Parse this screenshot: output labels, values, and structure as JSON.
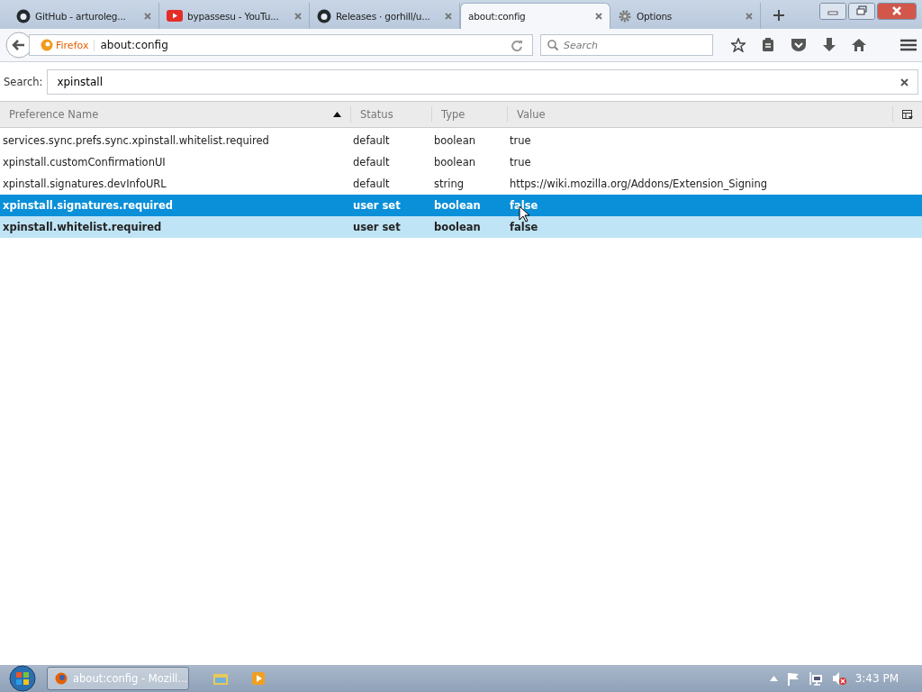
{
  "tabs": [
    {
      "title": "GitHub - arturoleg...",
      "kind": "github",
      "selected": false
    },
    {
      "title": "bypassesu - YouTu...",
      "kind": "youtube",
      "selected": false
    },
    {
      "title": "Releases · gorhill/u...",
      "kind": "github",
      "selected": false
    },
    {
      "title": "about:config",
      "kind": "plain",
      "selected": true
    },
    {
      "title": "Options",
      "kind": "gear",
      "selected": false
    }
  ],
  "navbar": {
    "identity": "Firefox",
    "url": "about:config",
    "search_placeholder": "Search"
  },
  "filter": {
    "label": "Search:",
    "value": "xpinstall"
  },
  "table": {
    "columns": [
      {
        "label": "Preference Name",
        "sorted": true
      },
      {
        "label": "Status",
        "sorted": false
      },
      {
        "label": "Type",
        "sorted": false
      },
      {
        "label": "Value",
        "sorted": false
      }
    ],
    "rows": [
      {
        "name": "services.sync.prefs.sync.xpinstall.whitelist.required",
        "status": "default",
        "type": "boolean",
        "value": "true",
        "modified": false,
        "selected": false,
        "hovered": false
      },
      {
        "name": "xpinstall.customConfirmationUI",
        "status": "default",
        "type": "boolean",
        "value": "true",
        "modified": false,
        "selected": false,
        "hovered": false
      },
      {
        "name": "xpinstall.signatures.devInfoURL",
        "status": "default",
        "type": "string",
        "value": "https://wiki.mozilla.org/Addons/Extension_Signing",
        "modified": false,
        "selected": false,
        "hovered": false
      },
      {
        "name": "xpinstall.signatures.required",
        "status": "user set",
        "type": "boolean",
        "value": "false",
        "modified": true,
        "selected": true,
        "hovered": false
      },
      {
        "name": "xpinstall.whitelist.required",
        "status": "user set",
        "type": "boolean",
        "value": "false",
        "modified": true,
        "selected": false,
        "hovered": true
      }
    ]
  },
  "taskbar": {
    "window": "about:config - Mozill...",
    "clock": "3:43 PM"
  }
}
